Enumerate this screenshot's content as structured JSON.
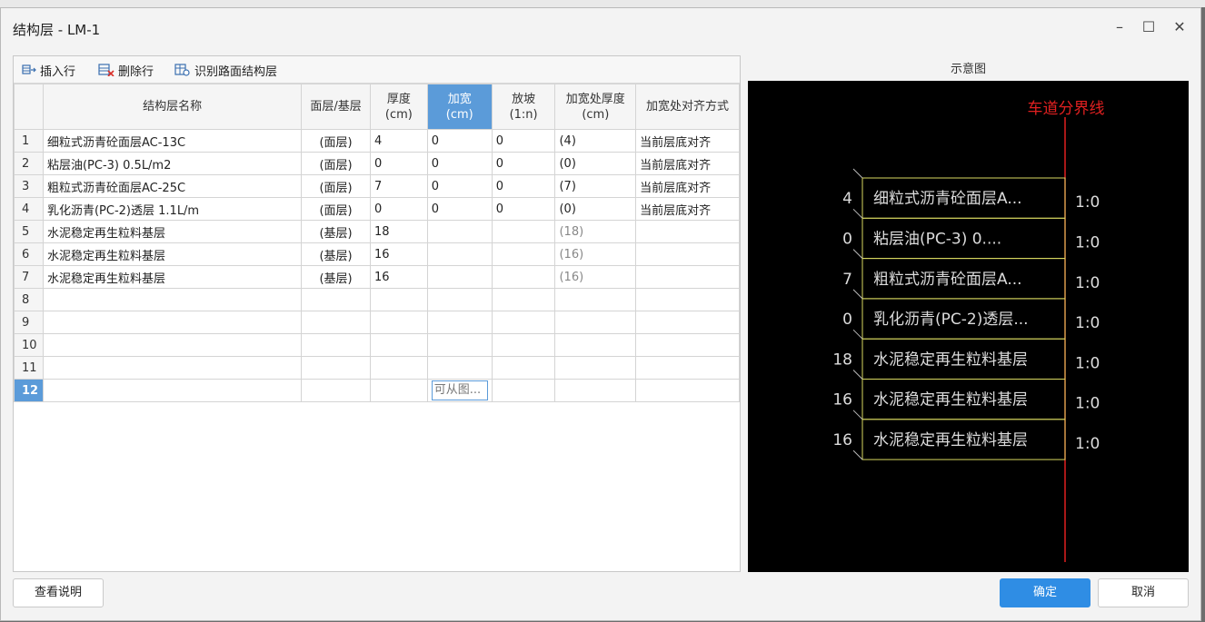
{
  "window": {
    "title": "结构层 - LM-1"
  },
  "toolbar": {
    "insert_row": "插入行",
    "delete_row": "删除行",
    "identify": "识别路面结构层"
  },
  "table": {
    "headers": [
      {
        "key": "name",
        "label": "结构层名称"
      },
      {
        "key": "type",
        "label": "面层/基层"
      },
      {
        "key": "thickness",
        "label": "厚度\n(cm)"
      },
      {
        "key": "widen",
        "label": "加宽\n(cm)"
      },
      {
        "key": "slope",
        "label": "放坡\n(1:n)"
      },
      {
        "key": "widen_thickness",
        "label": "加宽处厚度\n(cm)"
      },
      {
        "key": "align",
        "label": "加宽处对齐方式"
      }
    ],
    "rows": [
      {
        "num": "1",
        "name": "细粒式沥青砼面层AC-13C",
        "type": "(面层)",
        "thickness": "4",
        "widen": "0",
        "slope": "0",
        "widen_thickness": "(4)",
        "align": "当前层底对齐"
      },
      {
        "num": "2",
        "name": "粘层油(PC-3)      0.5L/m2",
        "type": "(面层)",
        "thickness": "0",
        "widen": "0",
        "slope": "0",
        "widen_thickness": "(0)",
        "align": "当前层底对齐"
      },
      {
        "num": "3",
        "name": "粗粒式沥青砼面层AC-25C",
        "type": "(面层)",
        "thickness": "7",
        "widen": "0",
        "slope": "0",
        "widen_thickness": "(7)",
        "align": "当前层底对齐"
      },
      {
        "num": "4",
        "name": "乳化沥青(PC-2)透层  1.1L/m",
        "type": "(面层)",
        "thickness": "0",
        "widen": "0",
        "slope": "0",
        "widen_thickness": "(0)",
        "align": "当前层底对齐"
      },
      {
        "num": "5",
        "name": "水泥稳定再生粒料基层",
        "type": "(基层)",
        "thickness": "18",
        "widen": "",
        "slope": "",
        "widen_thickness": "(18)",
        "align": ""
      },
      {
        "num": "6",
        "name": "水泥稳定再生粒料基层",
        "type": "(基层)",
        "thickness": "16",
        "widen": "",
        "slope": "",
        "widen_thickness": "(16)",
        "align": ""
      },
      {
        "num": "7",
        "name": "水泥稳定再生粒料基层",
        "type": "(基层)",
        "thickness": "16",
        "widen": "",
        "slope": "",
        "widen_thickness": "(16)",
        "align": ""
      },
      {
        "num": "8",
        "name": "",
        "type": "",
        "thickness": "",
        "widen": "",
        "slope": "",
        "widen_thickness": "",
        "align": ""
      },
      {
        "num": "9",
        "name": "",
        "type": "",
        "thickness": "",
        "widen": "",
        "slope": "",
        "widen_thickness": "",
        "align": ""
      },
      {
        "num": "10",
        "name": "",
        "type": "",
        "thickness": "",
        "widen": "",
        "slope": "",
        "widen_thickness": "",
        "align": ""
      },
      {
        "num": "11",
        "name": "",
        "type": "",
        "thickness": "",
        "widen": "",
        "slope": "",
        "widen_thickness": "",
        "align": ""
      },
      {
        "num": "12",
        "name": "",
        "type": "",
        "thickness": "",
        "widen": "可从图...",
        "slope": "",
        "widen_thickness": "",
        "align": ""
      }
    ],
    "selected_row": "12",
    "active_column": "widen"
  },
  "preview": {
    "label": "示意图",
    "divider_label": "车道分界线",
    "layers": [
      {
        "thickness": "4",
        "name": "细粒式沥青砼面层A...",
        "ratio": "1:0"
      },
      {
        "thickness": "0",
        "name": "粘层油(PC-3)      0....",
        "ratio": "1:0"
      },
      {
        "thickness": "7",
        "name": "粗粒式沥青砼面层A...",
        "ratio": "1:0"
      },
      {
        "thickness": "0",
        "name": "乳化沥青(PC-2)透层...",
        "ratio": "1:0"
      },
      {
        "thickness": "18",
        "name": "水泥稳定再生粒料基层",
        "ratio": "1:0"
      },
      {
        "thickness": "16",
        "name": "水泥稳定再生粒料基层",
        "ratio": "1:0"
      },
      {
        "thickness": "16",
        "name": "水泥稳定再生粒料基层",
        "ratio": "1:0"
      }
    ],
    "colors": {
      "background": "#000000",
      "divider": "#e02020",
      "layer_border": "#d8d860",
      "text": "#dcdcdc"
    }
  },
  "buttons": {
    "help": "查看说明",
    "ok": "确定",
    "cancel": "取消"
  }
}
